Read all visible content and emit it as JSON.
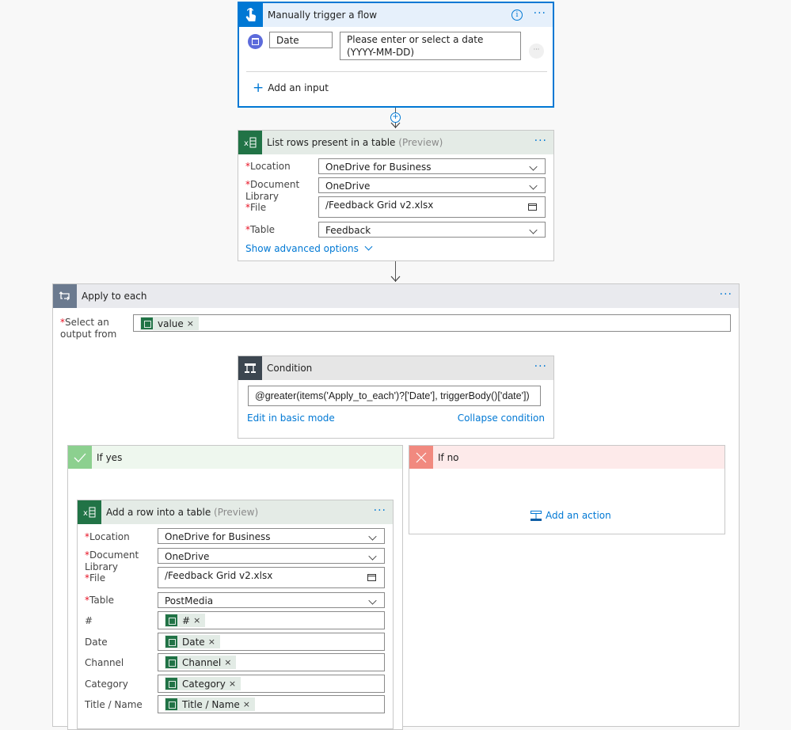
{
  "trigger": {
    "title": "Manually trigger a flow",
    "info_icon": "info-icon",
    "more_icon": "ellipsis-icon",
    "input_name": "Date",
    "input_placeholder": "Please enter or select a date (YYYY-MM-DD)",
    "add_input_label": "Add an input",
    "colors": {
      "header_bg": "#e6f0fb",
      "icon_bg": "#0078d4",
      "border": "#0078d4"
    }
  },
  "list_rows": {
    "title": "List rows present in a table",
    "preview": "(Preview)",
    "fields": [
      {
        "label": "Location",
        "required": true,
        "value": "OneDrive for Business",
        "type": "dropdown"
      },
      {
        "label": "Document Library",
        "required": true,
        "value": "OneDrive",
        "type": "dropdown"
      },
      {
        "label": "File",
        "required": true,
        "value": "/Feedback Grid v2.xlsx",
        "type": "file"
      },
      {
        "label": "Table",
        "required": true,
        "value": "Feedback",
        "type": "dropdown"
      }
    ],
    "advanced_label": "Show advanced options"
  },
  "apply_each": {
    "title": "Apply to each",
    "select_label": "Select an output from",
    "token": "value"
  },
  "condition": {
    "title": "Condition",
    "expression": "@greater(items('Apply_to_each')?['Date'], triggerBody()['date'])",
    "edit_basic_label": "Edit in basic mode",
    "collapse_label": "Collapse condition"
  },
  "if_yes": {
    "title": "If yes",
    "color": "#8cd08f"
  },
  "if_no": {
    "title": "If no",
    "color": "#f1897f",
    "add_action_label": "Add an action"
  },
  "add_row": {
    "title": "Add a row into a table",
    "preview": "(Preview)",
    "fields": [
      {
        "label": "Location",
        "required": true,
        "value": "OneDrive for Business",
        "type": "dropdown"
      },
      {
        "label": "Document Library",
        "required": true,
        "value": "OneDrive",
        "type": "dropdown"
      },
      {
        "label": "File",
        "required": true,
        "value": "/Feedback Grid v2.xlsx",
        "type": "file"
      },
      {
        "label": "Table",
        "required": true,
        "value": "PostMedia",
        "type": "dropdown"
      }
    ],
    "columns": [
      {
        "label": "#",
        "token": "#"
      },
      {
        "label": "Date",
        "token": "Date"
      },
      {
        "label": "Channel",
        "token": "Channel"
      },
      {
        "label": "Category",
        "token": "Category"
      },
      {
        "label": "Title / Name",
        "token": "Title / Name"
      }
    ]
  },
  "required_marker": "*",
  "token_remove": "×"
}
